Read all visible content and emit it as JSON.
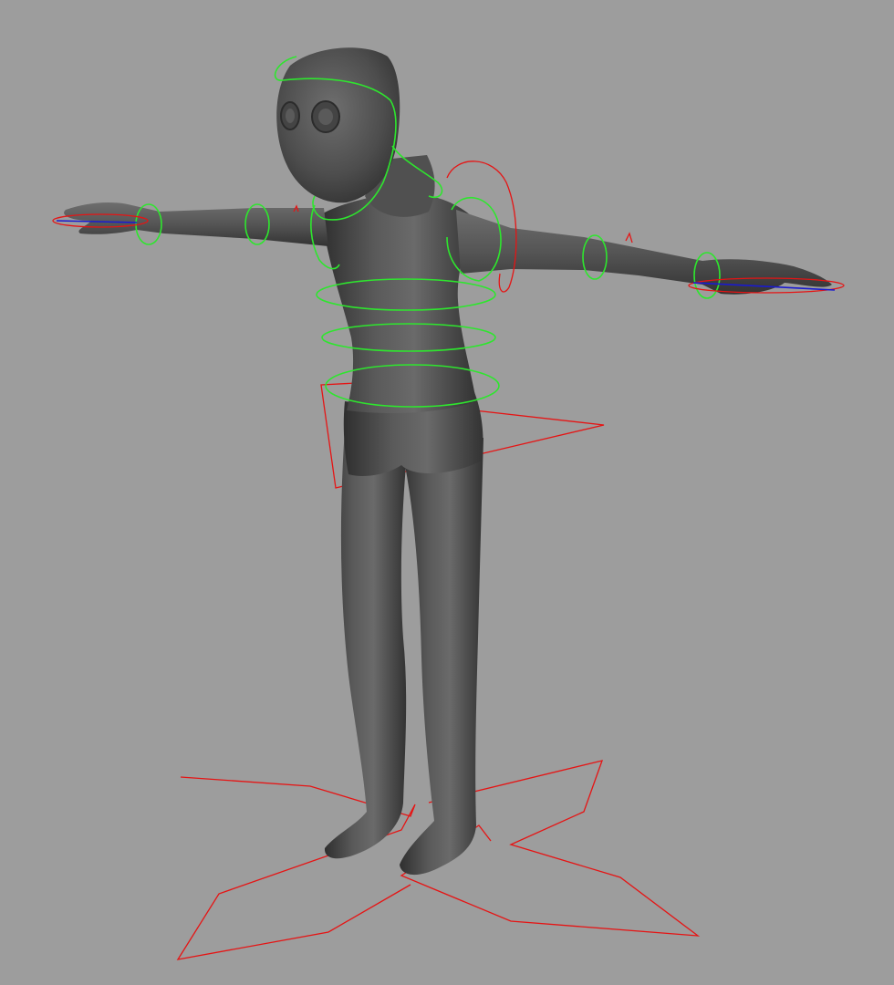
{
  "viewport": {
    "background_color": "#9d9d9d",
    "character": {
      "body_color": "#565656",
      "body_highlight": "#8a8a8a",
      "body_shadow": "#2f2f2f",
      "pose": "T-pose"
    },
    "controls": {
      "fk_color": "#2ee62e",
      "ik_color": "#e61414",
      "axis_color": "#1a1ad0"
    }
  }
}
